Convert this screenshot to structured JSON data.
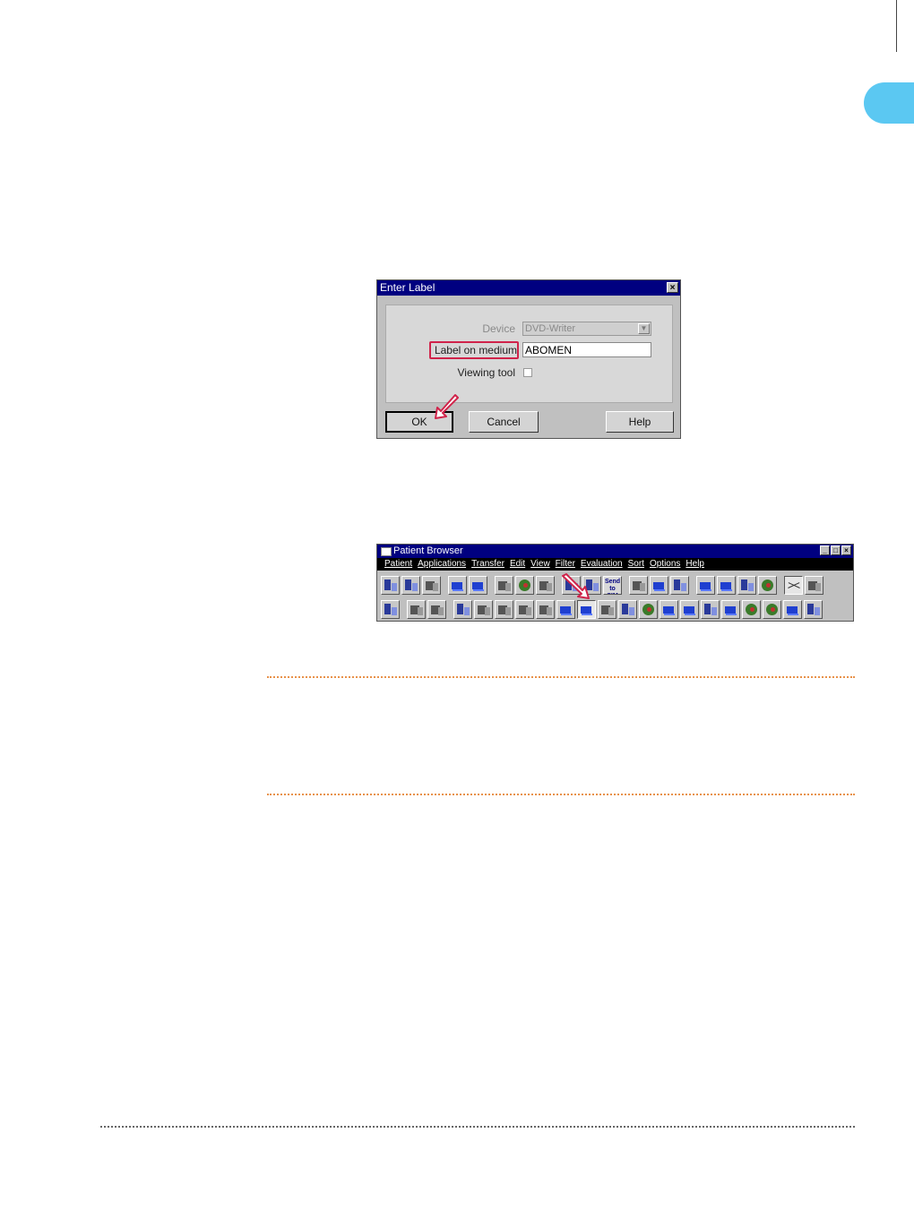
{
  "dialog": {
    "title": "Enter Label",
    "close_glyph": "×",
    "device_label": "Device",
    "device_value": "DVD-Writer",
    "label_field_label": "Label on medium",
    "label_field_value": "ABOMEN",
    "viewing_tool_label": "Viewing tool",
    "ok_label": "OK",
    "cancel_label": "Cancel",
    "help_label": "Help"
  },
  "browser": {
    "title": "Patient Browser",
    "window_buttons": [
      "_",
      "□",
      "×"
    ],
    "menus": [
      "Patient",
      "Applications",
      "Transfer",
      "Edit",
      "View",
      "Filter",
      "Evaluation",
      "Sort",
      "Options",
      "Help"
    ],
    "send_button_label": "Send to SIM"
  },
  "colors": {
    "tab_marker": "#5bc8f2",
    "highlight": "#d0234a",
    "titlebar": "#000080",
    "dotted_orange": "#e8924a",
    "dotted_gray": "#666666"
  }
}
